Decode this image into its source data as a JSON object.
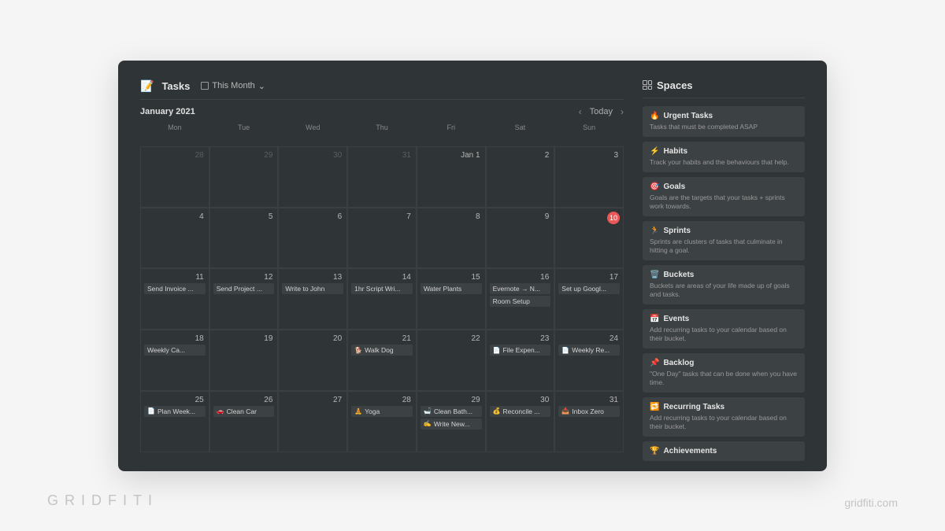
{
  "watermark": {
    "left": "GRIDFITI",
    "right": "gridfiti.com"
  },
  "header": {
    "icon": "📝",
    "title": "Tasks",
    "view_label": "This Month"
  },
  "calendar": {
    "month_label": "January 2021",
    "today_label": "Today",
    "weekdays": [
      "Mon",
      "Tue",
      "Wed",
      "Thu",
      "Fri",
      "Sat",
      "Sun"
    ],
    "weeks": [
      [
        {
          "num": "28",
          "muted": true,
          "events": []
        },
        {
          "num": "29",
          "muted": true,
          "events": []
        },
        {
          "num": "30",
          "muted": true,
          "events": []
        },
        {
          "num": "31",
          "muted": true,
          "events": []
        },
        {
          "num": "Jan 1",
          "events": []
        },
        {
          "num": "2",
          "events": []
        },
        {
          "num": "3",
          "events": []
        }
      ],
      [
        {
          "num": "4",
          "events": []
        },
        {
          "num": "5",
          "events": []
        },
        {
          "num": "6",
          "events": []
        },
        {
          "num": "7",
          "events": []
        },
        {
          "num": "8",
          "events": []
        },
        {
          "num": "9",
          "events": []
        },
        {
          "num": "10",
          "today": true,
          "events": []
        }
      ],
      [
        {
          "num": "11",
          "events": [
            {
              "label": "Send Invoice ..."
            }
          ]
        },
        {
          "num": "12",
          "events": [
            {
              "label": "Send Project ..."
            }
          ]
        },
        {
          "num": "13",
          "events": [
            {
              "label": "Write to John"
            }
          ]
        },
        {
          "num": "14",
          "events": [
            {
              "label": "1hr Script Wri..."
            }
          ]
        },
        {
          "num": "15",
          "events": [
            {
              "label": "Water Plants"
            }
          ]
        },
        {
          "num": "16",
          "events": [
            {
              "label": "Evernote → N..."
            },
            {
              "label": "Room Setup"
            }
          ]
        },
        {
          "num": "17",
          "events": [
            {
              "label": "Set up Googl..."
            }
          ]
        }
      ],
      [
        {
          "num": "18",
          "events": [
            {
              "icon": "",
              "label": "Weekly Ca..."
            }
          ]
        },
        {
          "num": "19",
          "events": []
        },
        {
          "num": "20",
          "events": []
        },
        {
          "num": "21",
          "events": [
            {
              "icon": "🐕",
              "label": "Walk Dog"
            }
          ]
        },
        {
          "num": "22",
          "events": []
        },
        {
          "num": "23",
          "events": [
            {
              "icon": "📄",
              "label": "File Expen..."
            }
          ]
        },
        {
          "num": "24",
          "events": [
            {
              "icon": "📄",
              "label": "Weekly Re..."
            }
          ]
        }
      ],
      [
        {
          "num": "25",
          "events": [
            {
              "icon": "📄",
              "label": "Plan Week..."
            }
          ]
        },
        {
          "num": "26",
          "events": [
            {
              "icon": "🚗",
              "label": "Clean Car"
            }
          ]
        },
        {
          "num": "27",
          "events": []
        },
        {
          "num": "28",
          "events": [
            {
              "icon": "🧘",
              "label": "Yoga"
            }
          ]
        },
        {
          "num": "29",
          "events": [
            {
              "icon": "🛁",
              "label": "Clean Bath..."
            },
            {
              "icon": "✍️",
              "label": "Write New..."
            }
          ]
        },
        {
          "num": "30",
          "events": [
            {
              "icon": "💰",
              "label": "Reconcile ..."
            }
          ]
        },
        {
          "num": "31",
          "events": [
            {
              "icon": "📥",
              "label": "Inbox Zero"
            }
          ]
        }
      ]
    ]
  },
  "sidebar": {
    "title": "Spaces",
    "spaces": [
      {
        "icon": "🔥",
        "title": "Urgent Tasks",
        "desc": "Tasks that must be completed ASAP"
      },
      {
        "icon": "⚡",
        "title": "Habits",
        "desc": "Track your habits and the behaviours that help."
      },
      {
        "icon": "🎯",
        "title": "Goals",
        "desc": "Goals are the targets that your tasks + sprints work towards."
      },
      {
        "icon": "🏃",
        "title": "Sprints",
        "desc": "Sprints are clusters of tasks that culminate in hitting a goal."
      },
      {
        "icon": "🗑️",
        "title": "Buckets",
        "desc": "Buckets are areas of your life made up of goals and tasks."
      },
      {
        "icon": "📅",
        "title": "Events",
        "desc": "Add recurring tasks to your calendar based on their bucket."
      },
      {
        "icon": "📌",
        "title": "Backlog",
        "desc": "\"One Day\" tasks that can be done when you have time."
      },
      {
        "icon": "🔁",
        "title": "Recurring Tasks",
        "desc": "Add recurring tasks to your calendar based on their bucket."
      },
      {
        "icon": "🏆",
        "title": "Achievements",
        "desc": ""
      }
    ]
  }
}
